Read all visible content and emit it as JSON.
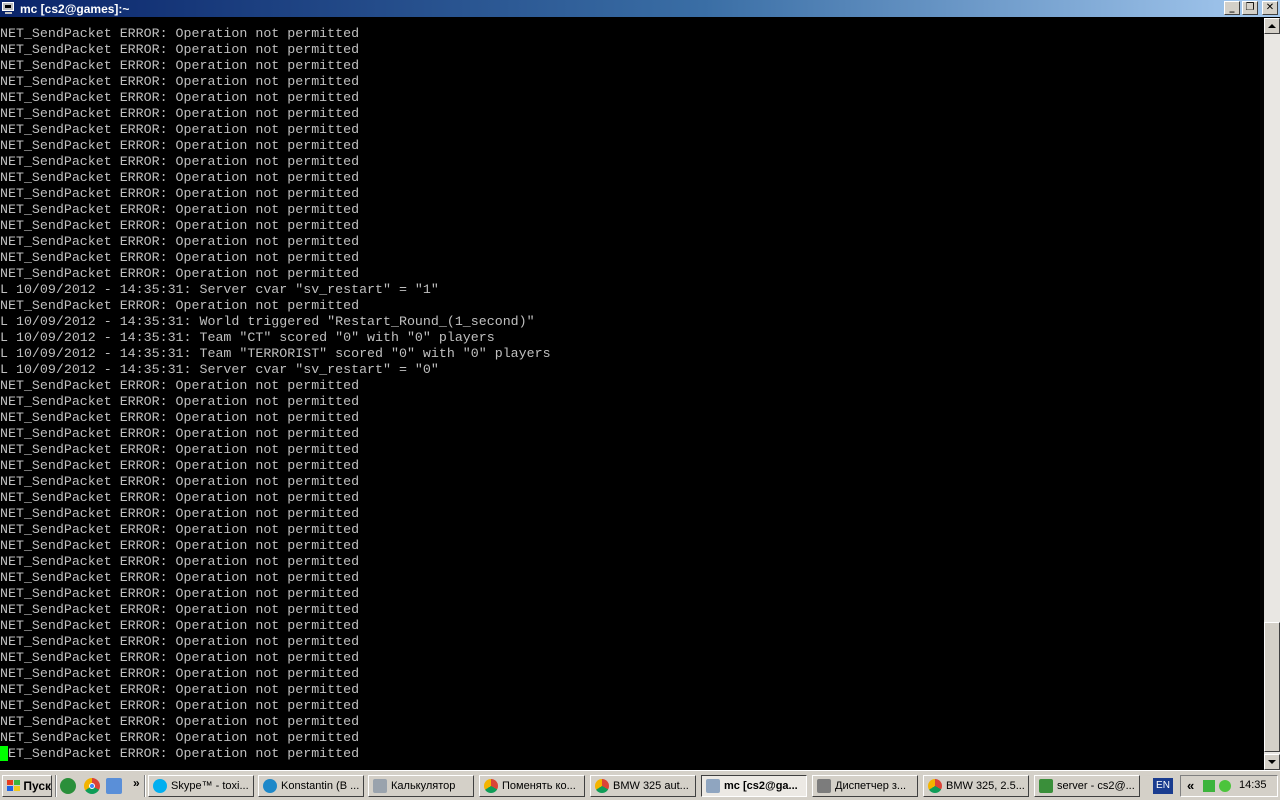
{
  "window": {
    "title": "mc [cs2@games]:~",
    "buttons": {
      "minimize": "_",
      "maximize": "❐",
      "close": "✕"
    }
  },
  "terminal": {
    "lines": [
      "NET_SendPacket ERROR: Operation not permitted",
      "NET_SendPacket ERROR: Operation not permitted",
      "NET_SendPacket ERROR: Operation not permitted",
      "NET_SendPacket ERROR: Operation not permitted",
      "NET_SendPacket ERROR: Operation not permitted",
      "NET_SendPacket ERROR: Operation not permitted",
      "NET_SendPacket ERROR: Operation not permitted",
      "NET_SendPacket ERROR: Operation not permitted",
      "NET_SendPacket ERROR: Operation not permitted",
      "NET_SendPacket ERROR: Operation not permitted",
      "NET_SendPacket ERROR: Operation not permitted",
      "NET_SendPacket ERROR: Operation not permitted",
      "NET_SendPacket ERROR: Operation not permitted",
      "NET_SendPacket ERROR: Operation not permitted",
      "NET_SendPacket ERROR: Operation not permitted",
      "NET_SendPacket ERROR: Operation not permitted",
      "L 10/09/2012 - 14:35:31: Server cvar \"sv_restart\" = \"1\"",
      "NET_SendPacket ERROR: Operation not permitted",
      "L 10/09/2012 - 14:35:31: World triggered \"Restart_Round_(1_second)\"",
      "L 10/09/2012 - 14:35:31: Team \"CT\" scored \"0\" with \"0\" players",
      "L 10/09/2012 - 14:35:31: Team \"TERRORIST\" scored \"0\" with \"0\" players",
      "L 10/09/2012 - 14:35:31: Server cvar \"sv_restart\" = \"0\"",
      "NET_SendPacket ERROR: Operation not permitted",
      "NET_SendPacket ERROR: Operation not permitted",
      "NET_SendPacket ERROR: Operation not permitted",
      "NET_SendPacket ERROR: Operation not permitted",
      "NET_SendPacket ERROR: Operation not permitted",
      "NET_SendPacket ERROR: Operation not permitted",
      "NET_SendPacket ERROR: Operation not permitted",
      "NET_SendPacket ERROR: Operation not permitted",
      "NET_SendPacket ERROR: Operation not permitted",
      "NET_SendPacket ERROR: Operation not permitted",
      "NET_SendPacket ERROR: Operation not permitted",
      "NET_SendPacket ERROR: Operation not permitted",
      "NET_SendPacket ERROR: Operation not permitted",
      "NET_SendPacket ERROR: Operation not permitted",
      "NET_SendPacket ERROR: Operation not permitted",
      "NET_SendPacket ERROR: Operation not permitted",
      "NET_SendPacket ERROR: Operation not permitted",
      "NET_SendPacket ERROR: Operation not permitted",
      "NET_SendPacket ERROR: Operation not permitted",
      "NET_SendPacket ERROR: Operation not permitted",
      "NET_SendPacket ERROR: Operation not permitted",
      "NET_SendPacket ERROR: Operation not permitted",
      "NET_SendPacket ERROR: Operation not permitted",
      "NET_SendPacket ERROR: Operation not permitted"
    ],
    "text_color": "#c0c0c0",
    "background": "#000000",
    "cursor_color": "#00ff00"
  },
  "taskbar": {
    "start_label": "Пуск",
    "quick_launch_icons": [
      "green-app-icon",
      "chrome-icon",
      "explorer-icon"
    ],
    "quick_launch_more": "»",
    "tasks": [
      {
        "label": "Skype™ - toxi...",
        "icon": "skype-icon"
      },
      {
        "label": "Konstantin (В ...",
        "icon": "chat-icon"
      },
      {
        "label": "Калькулятор",
        "icon": "calculator-icon"
      },
      {
        "label": "Поменять ко...",
        "icon": "chrome-icon"
      },
      {
        "label": "BMW 325 aut...",
        "icon": "chrome-icon"
      },
      {
        "label": "mc [cs2@ga...",
        "icon": "putty-icon",
        "active": true
      },
      {
        "label": "Диспетчер з...",
        "icon": "task-manager-icon"
      },
      {
        "label": "BMW 325, 2.5...",
        "icon": "chrome-icon"
      },
      {
        "label": "server - cs2@...",
        "icon": "server-icon"
      }
    ],
    "language": "EN",
    "tray_expand": "«",
    "clock": "14:35"
  }
}
